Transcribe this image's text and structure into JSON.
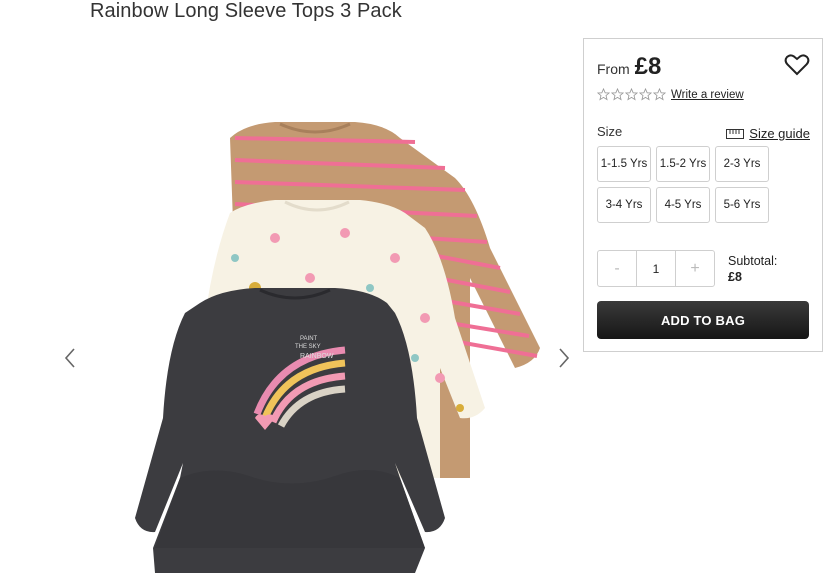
{
  "product": {
    "title": "Rainbow Long Sleeve Tops 3 Pack",
    "image_alt": "Three long sleeve tops: tan striped, cream printed, charcoal rainbow"
  },
  "gallery": {
    "prev_icon": "chevron-left-icon",
    "next_icon": "chevron-right-icon"
  },
  "panel": {
    "price_prefix": "From",
    "price": "£8",
    "wishlist_icon": "heart-icon",
    "rating": {
      "stars": 0,
      "max": 5
    },
    "review_link": "Write a review",
    "size_label": "Size",
    "size_guide_label": "Size guide",
    "size_guide_icon": "ruler-icon",
    "sizes": [
      "1-1.5 Yrs",
      "1.5-2 Yrs",
      "2-3 Yrs",
      "3-4 Yrs",
      "4-5 Yrs",
      "5-6 Yrs"
    ],
    "quantity": {
      "minus": "-",
      "value": "1",
      "plus": "+"
    },
    "subtotal_label": "Subtotal:",
    "subtotal_value": "£8",
    "add_to_bag": "ADD TO BAG"
  },
  "colors": {
    "button_bg": "#222222",
    "border": "#cfcfcf"
  }
}
